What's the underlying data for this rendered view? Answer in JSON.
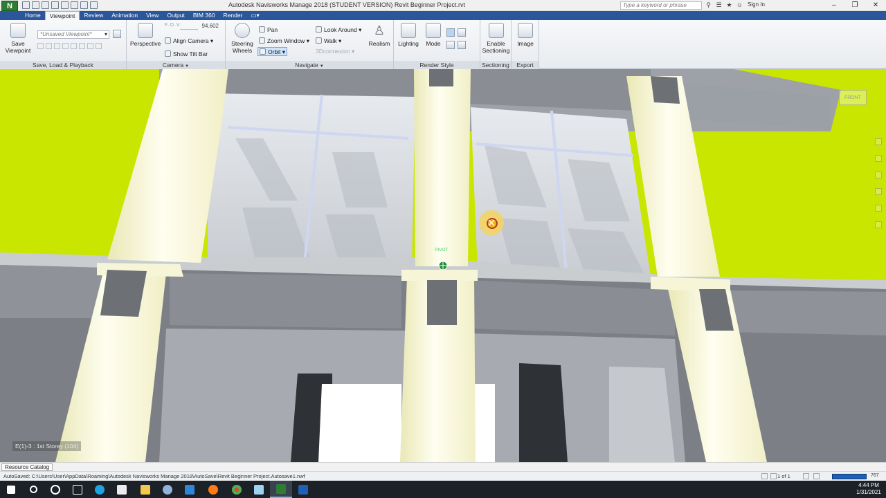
{
  "app": {
    "logo": "N",
    "window_title": "Autodesk Navisworks Manage 2018 (STUDENT VERSION)     Revit Beginner Project.rvt",
    "search_placeholder": "Type a keyword or phrase",
    "sign_in": "Sign In"
  },
  "tabs": [
    "Home",
    "Viewpoint",
    "Review",
    "Animation",
    "View",
    "Output",
    "BIM 360",
    "Render"
  ],
  "active_tab": "Viewpoint",
  "ribbon": {
    "save_load": {
      "save_viewpoint": "Save Viewpoint",
      "viewpoint_combo": "*Unsaved Viewpoint*",
      "panel_label": "Save, Load & Playback"
    },
    "camera": {
      "perspective": "Perspective",
      "fov_label": "F.O.V.",
      "fov_value": "94.602",
      "align_camera": "Align Camera",
      "show_tilt_bar": "Show Tilt Bar",
      "panel_label": "Camera"
    },
    "navigate": {
      "steering_wheels": "Steering Wheels",
      "pan": "Pan",
      "zoom_window": "Zoom Window",
      "orbit": "Orbit",
      "look_around": "Look Around",
      "walk": "Walk",
      "connexion": "3Dconnexion",
      "realism": "Realism",
      "panel_label": "Navigate"
    },
    "render_style": {
      "lighting": "Lighting",
      "mode": "Mode",
      "panel_label": "Render Style"
    },
    "sectioning": {
      "enable_sectioning": "Enable Sectioning",
      "panel_label": "Sectioning"
    },
    "export": {
      "image": "Image",
      "panel_label": "Export"
    }
  },
  "viewport": {
    "location_label": "E(1)-3 : 1st Storey (104)",
    "pivot_label": "PIVOT",
    "viewcube_face": "FRONT"
  },
  "resource_catalog": "Resource Catalog",
  "status": {
    "autosave": "AutoSaved: C:\\Users\\User\\AppData\\Roaming\\Autodesk Navisworks Manage 2018\\AutoSave\\Revit Beginner Project.Autosave1.nwf",
    "page": "1 of 1",
    "memory": "767"
  },
  "taskbar": {
    "time": "4:44 PM",
    "date": "1/31/2021"
  },
  "colors": {
    "tab_bar": "#2b579a",
    "background_green": "#c8e600",
    "column": "#fffde0",
    "concrete": "#8c9096",
    "taskbar": "#1c2128"
  }
}
